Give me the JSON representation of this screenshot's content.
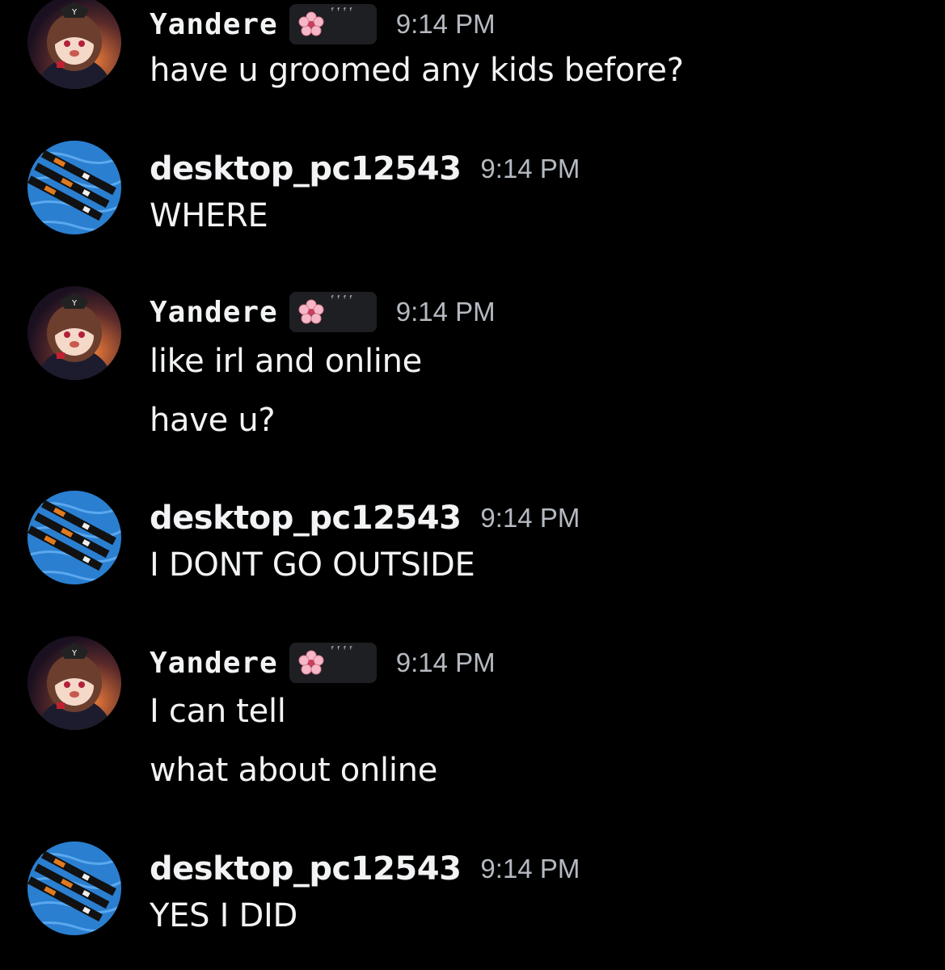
{
  "messages": [
    {
      "author": "Yandere",
      "tag_text": "ᶠᶠᶠᶠ",
      "time": "9:14 PM",
      "lines": [
        "have u groomed any kids before?"
      ]
    },
    {
      "author": "desktop_pc12543",
      "time": "9:14 PM",
      "lines": [
        "WHERE"
      ]
    },
    {
      "author": "Yandere",
      "tag_text": "ᶠᶠᶠᶠ",
      "time": "9:14 PM",
      "lines": [
        "like irl and online",
        "have u?"
      ]
    },
    {
      "author": "desktop_pc12543",
      "time": "9:14 PM",
      "lines": [
        "I DONT GO OUTSIDE"
      ]
    },
    {
      "author": "Yandere",
      "tag_text": "ᶠᶠᶠᶠ",
      "time": "9:14 PM",
      "lines": [
        "I can tell",
        "what about online"
      ]
    },
    {
      "author": "desktop_pc12543",
      "time": "9:14 PM",
      "lines": [
        "YES I DID"
      ]
    }
  ],
  "icons": {
    "yandere_avatar": "anime-girl-avatar-icon",
    "desktop_avatar": "ocean-ships-avatar-icon",
    "tag_badge": "cherry-blossom-icon"
  },
  "colors": {
    "background": "#000000",
    "text": "#f2f3f5",
    "timestamp": "#b5bac1",
    "tag_bg": "#1e1f22"
  }
}
